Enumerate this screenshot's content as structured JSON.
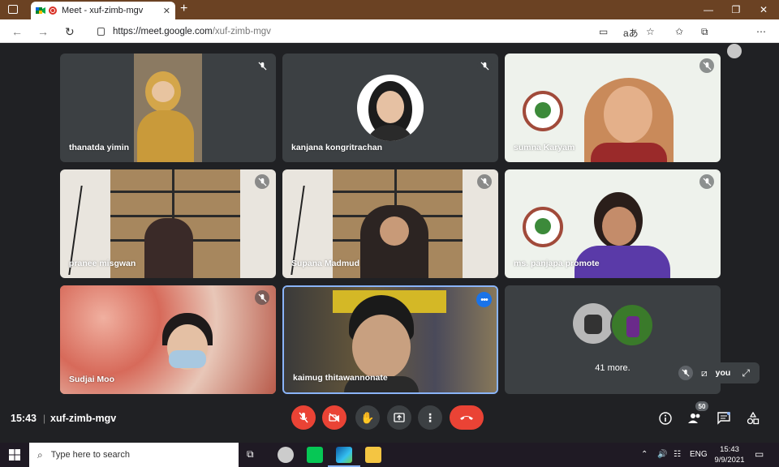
{
  "browser": {
    "tab_title": "Meet - xuf-zimb-mgv",
    "tab_close": "✕",
    "new_tab": "+",
    "url_host": "https://meet.google.com",
    "url_path": "/xuf-zimb-mgv",
    "window_controls": [
      "—",
      "❐",
      "✕"
    ]
  },
  "participants": [
    {
      "name": "thanatda yimin",
      "muted": true,
      "bg": "#7a6a55"
    },
    {
      "name": "kanjana kongritrachan",
      "muted": true,
      "bg": "#3c4043"
    },
    {
      "name": "sumna Karyam",
      "muted": true,
      "bg": "#e8efe6"
    },
    {
      "name": "pranee misgwan",
      "muted": true,
      "bg": "#b8a48a"
    },
    {
      "name": "Supana Madmud",
      "muted": true,
      "bg": "#b8a48a"
    },
    {
      "name": "ms. panjapa promote",
      "muted": true,
      "bg": "#e8efe6"
    },
    {
      "name": "Sudjai Moo",
      "muted": true,
      "bg": "#d98a78"
    },
    {
      "name": "kaimug thitawannonate",
      "muted": false,
      "bg": "#5a5442"
    }
  ],
  "more_tile": {
    "label": "41 more."
  },
  "self_view": {
    "label": "you"
  },
  "bottom": {
    "time": "15:43",
    "separator": "|",
    "meeting_code": "xuf-zimb-mgv",
    "people_count": "50"
  },
  "taskbar": {
    "search_placeholder": "Type here to search",
    "lang": "ENG",
    "time": "15:43",
    "date": "9/9/2021"
  },
  "colors": {
    "meet_bg": "#202124",
    "tile_bg": "#3c4043",
    "end_call": "#ea4335",
    "accent": "#1a73e8",
    "tab_strip": "#6b4223"
  }
}
